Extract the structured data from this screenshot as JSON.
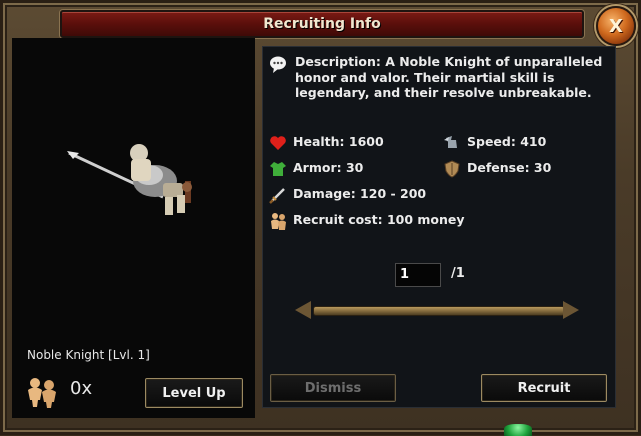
{
  "window": {
    "title": "Recruiting Info",
    "close_label": "X"
  },
  "unit": {
    "name": "Noble Knight [Lvl. 1]",
    "count": "0x",
    "level_up_label": "Level Up"
  },
  "details": {
    "description": "Description: A Noble Knight of unparalleled honor and valor. Their martial skill is legendary, and their resolve unbreakable.",
    "stats": {
      "health": "Health: 1600",
      "speed": "Speed: 410",
      "armor": "Armor: 30",
      "defense": "Defense: 30",
      "damage": "Damage: 120 - 200",
      "recruit_cost": "Recruit cost: 100 money"
    },
    "quantity": {
      "value": "1",
      "max": "/1",
      "slider_fraction": 1.0
    },
    "dismiss_label": "Dismiss",
    "recruit_label": "Recruit"
  },
  "icons": {
    "close": "close-icon",
    "description": "speech-bubble-icon",
    "health": "heart-icon",
    "speed": "winged-boot-icon",
    "armor": "tunic-icon",
    "defense": "shield-icon",
    "damage": "sword-icon",
    "recruit_cost": "people-icon"
  },
  "colors": {
    "title_bar": "#5a0f0b",
    "frame": "#4a3b28",
    "panel": "#111418",
    "text": "#ececec"
  }
}
